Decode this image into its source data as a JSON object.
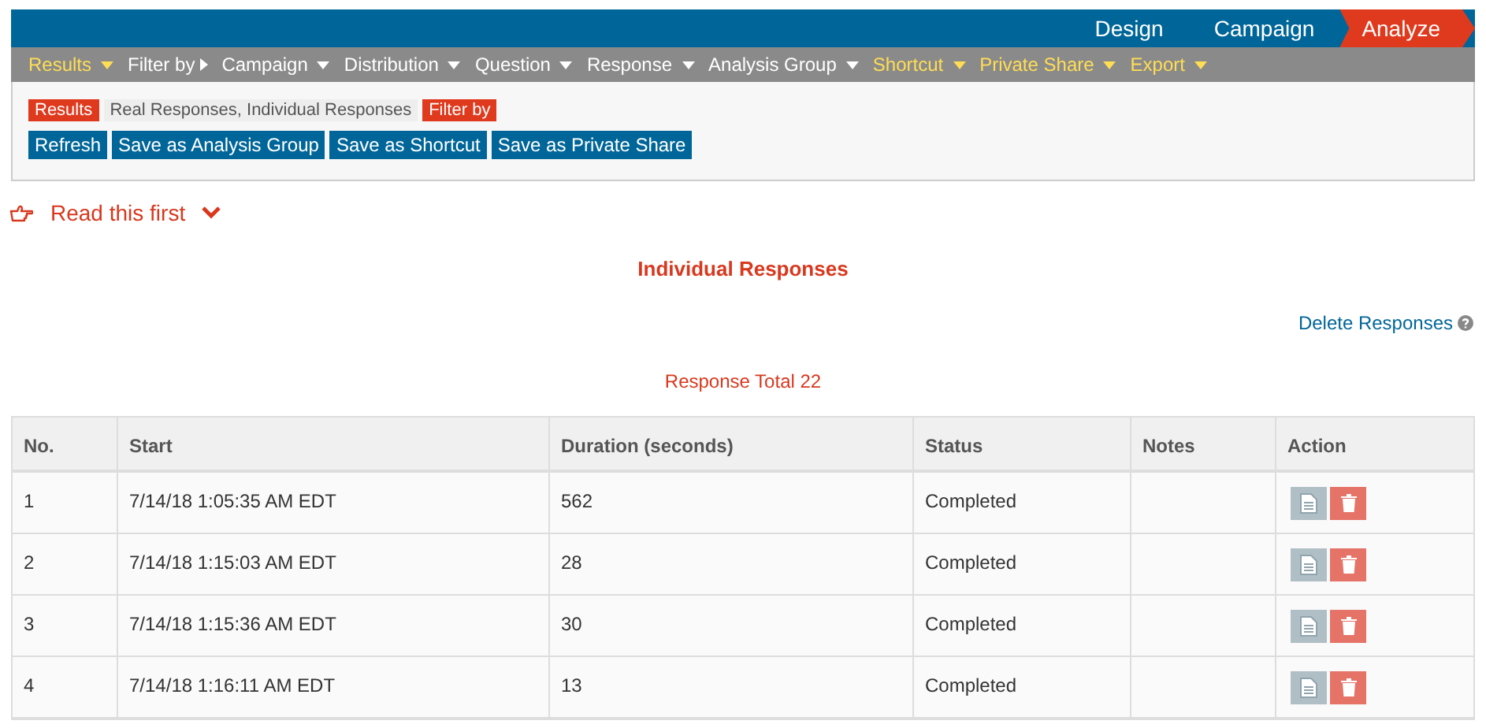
{
  "tabs": [
    {
      "label": "Design",
      "selected": false
    },
    {
      "label": "Campaign",
      "selected": false
    },
    {
      "label": "Analyze",
      "selected": true
    }
  ],
  "menu": [
    {
      "label": "Results",
      "kind": "dropdown",
      "accent": true
    },
    {
      "label": "Filter by",
      "kind": "submenu",
      "accent": false
    },
    {
      "label": "Campaign",
      "kind": "dropdown",
      "accent": false
    },
    {
      "label": "Distribution",
      "kind": "dropdown",
      "accent": false
    },
    {
      "label": "Question",
      "kind": "dropdown",
      "accent": false
    },
    {
      "label": "Response",
      "kind": "dropdown",
      "accent": false
    },
    {
      "label": "Analysis Group",
      "kind": "dropdown",
      "accent": false
    },
    {
      "label": "Shortcut",
      "kind": "dropdown",
      "accent": true
    },
    {
      "label": "Private Share",
      "kind": "dropdown",
      "accent": true
    },
    {
      "label": "Export",
      "kind": "dropdown",
      "accent": true
    }
  ],
  "breadcrumb": [
    {
      "label": "Results",
      "kind": "tag"
    },
    {
      "label": "Real Responses, Individual Responses",
      "kind": "plain"
    },
    {
      "label": "Filter by",
      "kind": "tag"
    }
  ],
  "buttons": [
    "Refresh",
    "Save as Analysis Group",
    "Save as Shortcut",
    "Save as Private Share"
  ],
  "notice": {
    "label": "Read this first",
    "expanded": false
  },
  "title": "Individual Responses",
  "delete_link": "Delete Responses",
  "total": "Response Total 22",
  "table": {
    "columns": [
      "No.",
      "Start",
      "Duration (seconds)",
      "Status",
      "Notes",
      "Action"
    ],
    "rows": [
      {
        "no": "1",
        "start": "7/14/18 1:05:35 AM EDT",
        "duration": "562",
        "status": "Completed"
      },
      {
        "no": "2",
        "start": "7/14/18 1:15:03 AM EDT",
        "duration": "28",
        "status": "Completed"
      },
      {
        "no": "3",
        "start": "7/14/18 1:15:36 AM EDT",
        "duration": "30",
        "status": "Completed"
      },
      {
        "no": "4",
        "start": "7/14/18 1:16:11 AM EDT",
        "duration": "13",
        "status": "Completed"
      }
    ]
  }
}
